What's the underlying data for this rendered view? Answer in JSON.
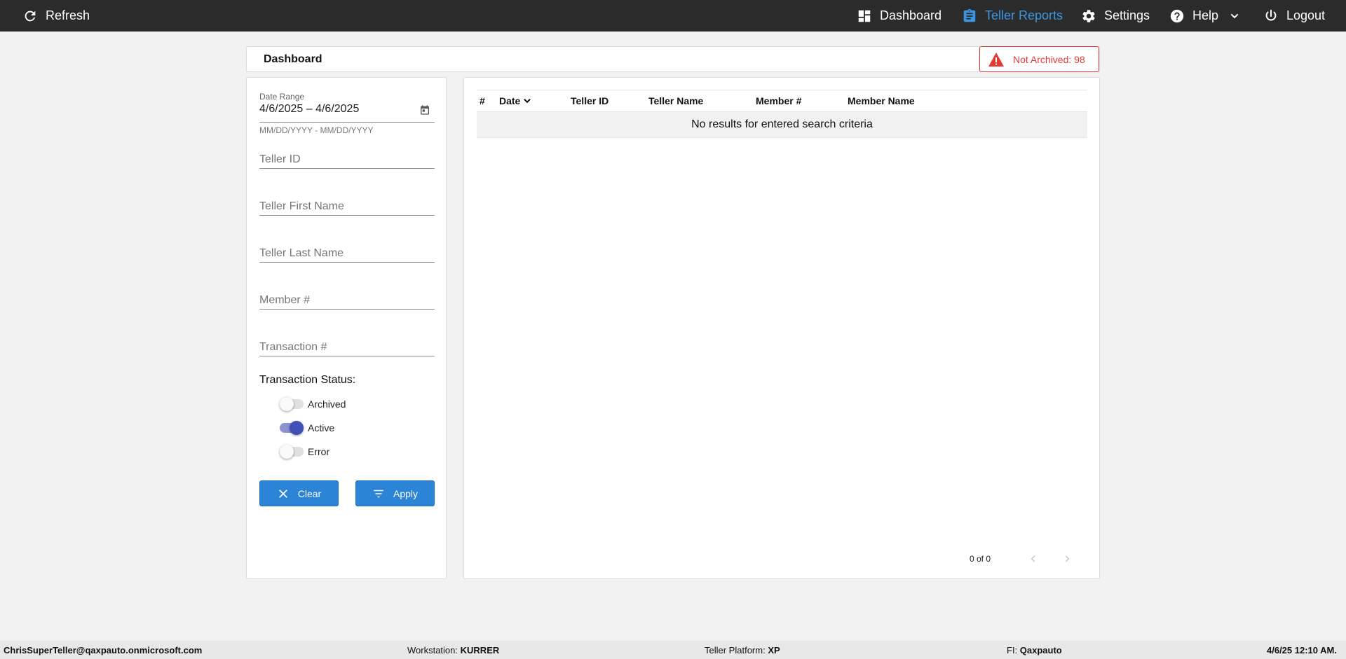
{
  "topbar": {
    "refresh_label": "Refresh",
    "dashboard_label": "Dashboard",
    "teller_reports_label": "Teller Reports",
    "settings_label": "Settings",
    "help_label": "Help",
    "logout_label": "Logout",
    "active_item": "Teller Reports",
    "bg_color": "#2b2b2b",
    "active_color": "#3d95e0"
  },
  "header": {
    "title": "Dashboard",
    "alert_text": "Not Archived: 98",
    "alert_color": "#e53935"
  },
  "filters": {
    "date_range_label": "Date Range",
    "date_range_value": "4/6/2025 – 4/6/2025",
    "date_hint": "MM/DD/YYYY - MM/DD/YYYY",
    "teller_id_placeholder": "Teller ID",
    "teller_first_name_placeholder": "Teller First Name",
    "teller_last_name_placeholder": "Teller Last Name",
    "member_number_placeholder": "Member #",
    "transaction_number_placeholder": "Transaction #",
    "status_label": "Transaction Status:",
    "statuses": [
      {
        "label": "Archived",
        "on": false
      },
      {
        "label": "Active",
        "on": true
      },
      {
        "label": "Error",
        "on": false
      }
    ],
    "clear_label": "Clear",
    "apply_label": "Apply",
    "button_color": "#2b84d6"
  },
  "table": {
    "columns": [
      "#",
      "Date",
      "Teller ID",
      "Teller Name",
      "Member #",
      "Member Name"
    ],
    "sorted_column": "Date",
    "empty_message": "No results for entered search criteria",
    "pager_text": "0 of 0"
  },
  "statusbar": {
    "user": "ChrisSuperTeller@qaxpauto.onmicrosoft.com",
    "workstation_label": "Workstation:",
    "workstation_value": "KURRER",
    "platform_label": "Teller Platform:",
    "platform_value": "XP",
    "fi_label": "FI:",
    "fi_value": "Qaxpauto",
    "datetime": "4/6/25 12:10 AM."
  }
}
